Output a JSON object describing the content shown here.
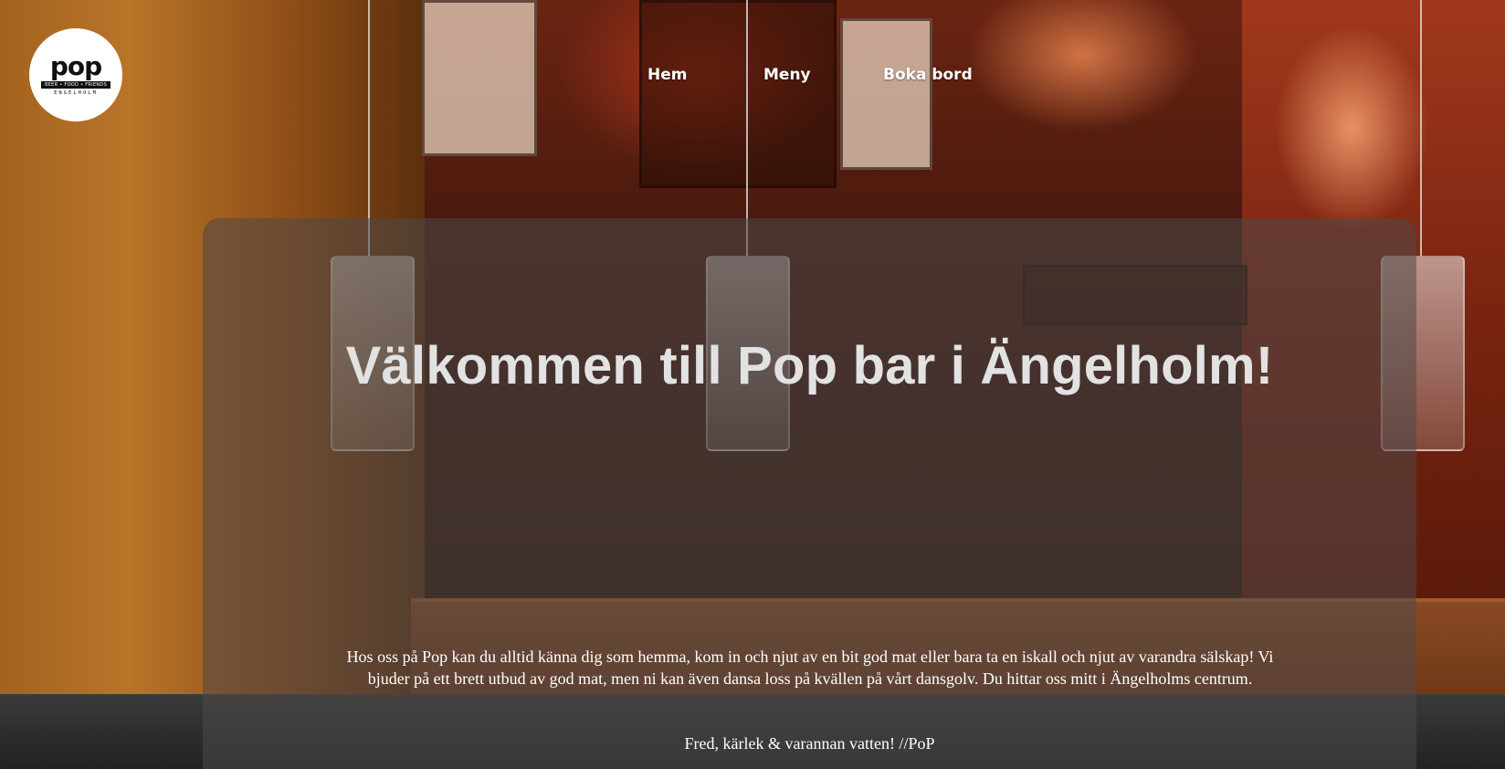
{
  "logo": {
    "word": "pop",
    "tagline": "BEER • FOOD • FRIENDS",
    "city": "ENGELHOLM"
  },
  "nav": {
    "items": [
      {
        "label": "Hem"
      },
      {
        "label": "Meny"
      },
      {
        "label": "Boka bord"
      }
    ]
  },
  "hero": {
    "title": "Välkommen till Pop bar i Ängelholm!",
    "body": "Hos oss på Pop kan du alltid känna dig som hemma, kom in och njut av en bit god mat eller bara ta en iskall och njut av varandra sälskap! Vi bjuder på ett brett utbud av god mat, men ni kan även dansa loss på kvällen på vårt dansgolv. Du hittar oss mitt i Ängelholms centrum.",
    "signoff": "Fred, kärlek & varannan vatten! //PoP"
  }
}
